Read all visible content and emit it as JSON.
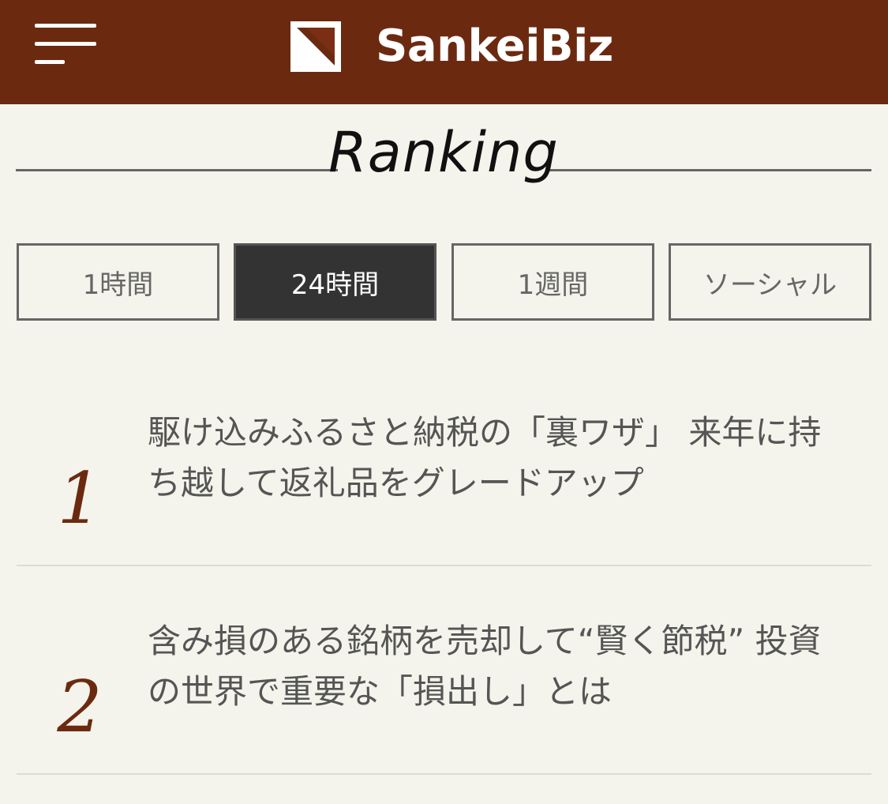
{
  "header": {
    "logo_text": "SankeiBiz",
    "background_color": "#6b2a10",
    "menu_icon": "hamburger-menu-icon",
    "logo_icon": "sankeibiz-logo-mark-icon"
  },
  "section": {
    "title": "Ranking"
  },
  "tabs": [
    {
      "label": "1時間",
      "active": false
    },
    {
      "label": "24時間",
      "active": true
    },
    {
      "label": "1週間",
      "active": false
    },
    {
      "label": "ソーシャル",
      "active": false
    }
  ],
  "ranking": [
    {
      "rank": "1",
      "title": "駆け込みふるさと納税の「裏ワザ」 来年に持ち越して返礼品をグレードアップ"
    },
    {
      "rank": "2",
      "title": "含み損のある銘柄を売却して“賢く節税” 投資の世界で重要な「損出し」とは"
    }
  ],
  "colors": {
    "accent": "#6b2a10",
    "active_tab": "#333333",
    "page_background": "#f4f4ec"
  }
}
